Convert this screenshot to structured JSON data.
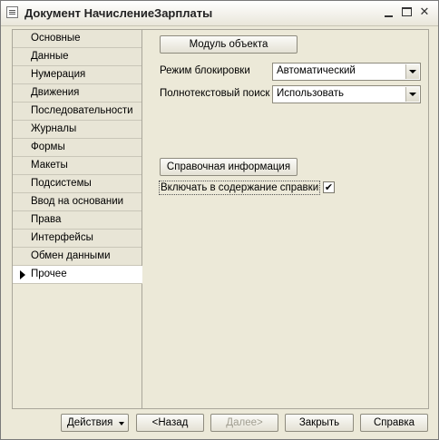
{
  "window": {
    "title": "Документ НачислениеЗарплаты",
    "minimize_icon": "minimize-icon",
    "maximize_icon": "maximize-icon",
    "close_label": "✕"
  },
  "sidebar": {
    "items": [
      {
        "label": "Основные"
      },
      {
        "label": "Данные"
      },
      {
        "label": "Нумерация"
      },
      {
        "label": "Движения"
      },
      {
        "label": "Последовательности"
      },
      {
        "label": "Журналы"
      },
      {
        "label": "Формы"
      },
      {
        "label": "Макеты"
      },
      {
        "label": "Подсистемы"
      },
      {
        "label": "Ввод на основании"
      },
      {
        "label": "Права"
      },
      {
        "label": "Интерфейсы"
      },
      {
        "label": "Обмен данными"
      },
      {
        "label": "Прочее"
      }
    ],
    "active_index": 13
  },
  "panel": {
    "module_button": "Модуль объекта",
    "lock_mode_label": "Режим блокировки",
    "lock_mode_value": "Автоматический",
    "fulltext_label": "Полнотекстовый поиск",
    "fulltext_value": "Использовать",
    "help_button": "Справочная информация",
    "include_help_label": "Включать в содержание справки",
    "include_help_checked": "✔"
  },
  "footer": {
    "actions": "Действия",
    "back": "<Назад",
    "next": "Далее>",
    "close": "Закрыть",
    "help": "Справка"
  }
}
